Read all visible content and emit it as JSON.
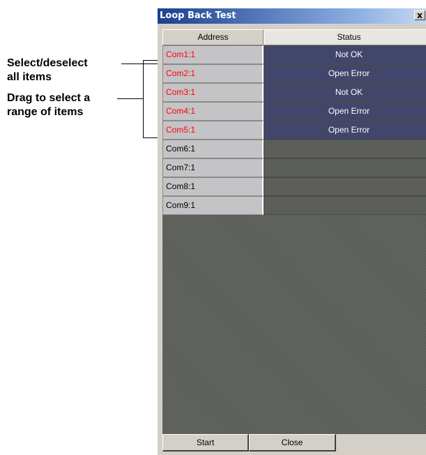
{
  "annotations": {
    "select_deselect": [
      "Select/deselect",
      "all items"
    ],
    "drag_select": [
      "Drag to select a",
      "range of items"
    ]
  },
  "window": {
    "title": "Loop Back Test",
    "close_glyph": "x"
  },
  "table": {
    "columns": [
      "Address",
      "Status"
    ],
    "rows": [
      {
        "address": "Com1:1",
        "status": "Not OK",
        "selected": true
      },
      {
        "address": "Com2:1",
        "status": "Open Error",
        "selected": true
      },
      {
        "address": "Com3:1",
        "status": "Not OK",
        "selected": true
      },
      {
        "address": "Com4:1",
        "status": "Open Error",
        "selected": true
      },
      {
        "address": "Com5:1",
        "status": "Open Error",
        "selected": true
      },
      {
        "address": "Com6:1",
        "status": "",
        "selected": false
      },
      {
        "address": "Com7:1",
        "status": "",
        "selected": false
      },
      {
        "address": "Com8:1",
        "status": "",
        "selected": false
      },
      {
        "address": "Com9:1",
        "status": "",
        "selected": false
      }
    ]
  },
  "buttons": {
    "start": "Start",
    "close": "Close"
  },
  "colors": {
    "selected_text": "#ff0000",
    "status_fill": "#42466a",
    "grid_background": "#5c5e5a"
  }
}
